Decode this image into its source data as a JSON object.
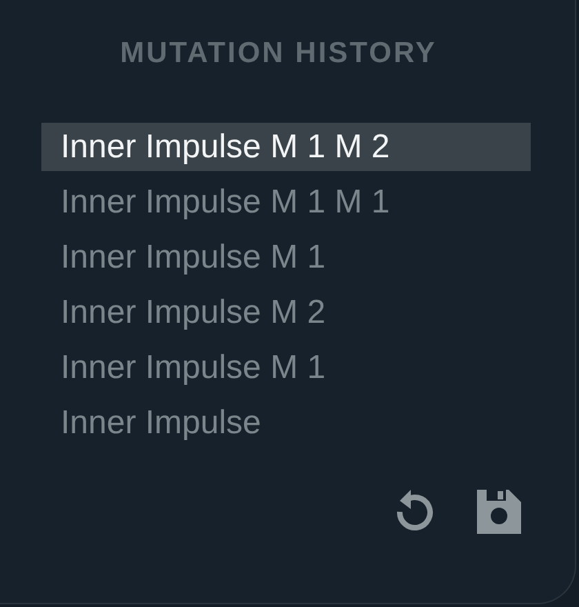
{
  "title": "MUTATION HISTORY",
  "items": [
    {
      "label": "Inner Impulse M 1 M 2",
      "selected": true
    },
    {
      "label": "Inner Impulse M 1 M 1",
      "selected": false
    },
    {
      "label": "Inner Impulse M 1",
      "selected": false
    },
    {
      "label": "Inner Impulse M 2",
      "selected": false
    },
    {
      "label": "Inner Impulse M 1",
      "selected": false
    },
    {
      "label": "Inner Impulse",
      "selected": false
    }
  ]
}
